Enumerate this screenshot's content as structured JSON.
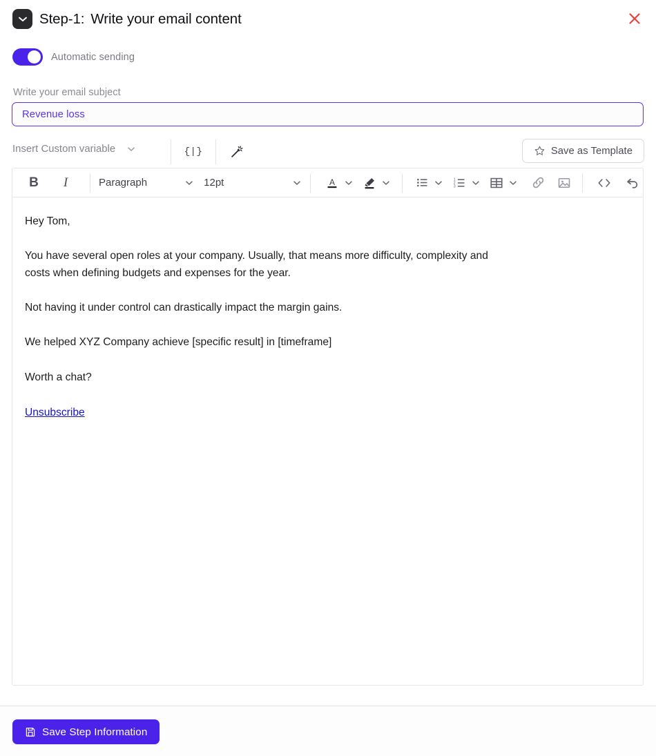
{
  "header": {
    "icon": "mail-envelope-icon",
    "step_label": "Step-1:",
    "title": "Write your email content",
    "close_icon": "close-icon",
    "close_color": "#e8413c"
  },
  "automatic_sending": {
    "label": "Automatic sending",
    "enabled": true,
    "accent": "#4b22ea"
  },
  "subject": {
    "label": "Write your email subject",
    "value": "Revenue loss",
    "placeholder": "Write your email subject",
    "border_color": "#5b31ea",
    "text_color": "#5b31ea"
  },
  "variable_bar": {
    "select_label": "Insert Custom variable",
    "chevron_icon": "chevron-down-icon",
    "brace_icon": "curly-brace-variable-icon",
    "brace_glyph": "{|}",
    "wand_icon": "magic-wand-icon",
    "template_button": {
      "label": "Save as Template",
      "icon": "star-icon"
    }
  },
  "toolbar": {
    "bold_label": "B",
    "italic_label": "I",
    "block_format": "Paragraph",
    "font_size": "12pt",
    "items": [
      {
        "name": "text-color-icon",
        "label": "A"
      },
      {
        "name": "highlight-color-icon",
        "label": ""
      },
      {
        "name": "bulleted-list-icon",
        "label": ""
      },
      {
        "name": "numbered-list-icon",
        "label": ""
      },
      {
        "name": "table-icon",
        "label": ""
      },
      {
        "name": "link-icon",
        "label": ""
      },
      {
        "name": "image-icon",
        "label": ""
      },
      {
        "name": "source-code-icon",
        "label": "<>"
      },
      {
        "name": "undo-icon",
        "label": ""
      }
    ]
  },
  "email_body": {
    "paragraphs": [
      "Hey Tom,",
      "You have several open roles at your company. Usually, that means more difficulty, complexity and costs when defining budgets and expenses for the year.",
      "Not having it under control can drastically impact the margin gains.",
      "We helped XYZ Company achieve [specific result] in [timeframe]",
      "Worth a chat?"
    ],
    "unsubscribe_label": "Unsubscribe",
    "unsubscribe_color": "#1414cc"
  },
  "footer": {
    "save_button_label": "Save Step Information",
    "save_button_icon": "floppy-disk-save-icon",
    "save_button_color": "#4b22ea"
  }
}
